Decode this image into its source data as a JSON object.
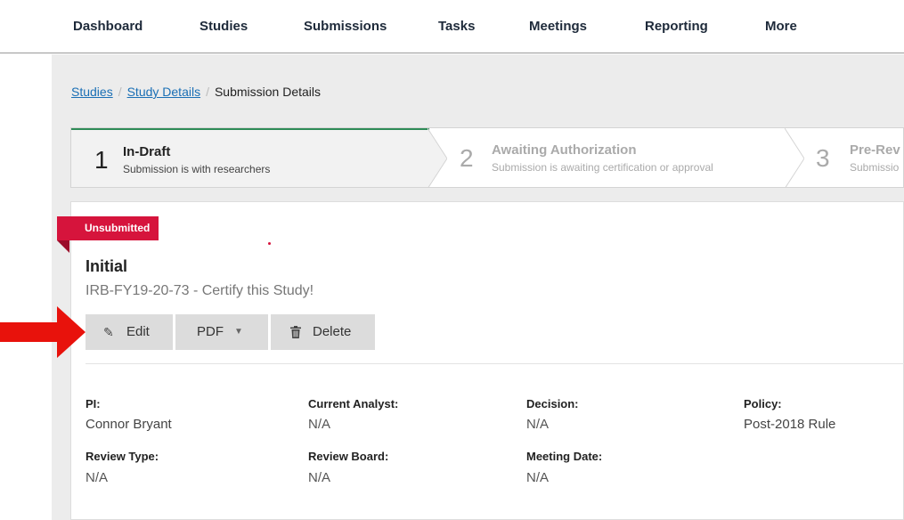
{
  "nav": {
    "items": [
      "Dashboard",
      "Studies",
      "Submissions",
      "Tasks",
      "Meetings",
      "Reporting",
      "More"
    ]
  },
  "breadcrumb": {
    "studies": "Studies",
    "study_details": "Study Details",
    "sep": "/",
    "current": "Submission Details"
  },
  "stepper": {
    "steps": [
      {
        "num": "1",
        "title": "In-Draft",
        "subtitle": "Submission is with researchers"
      },
      {
        "num": "2",
        "title": "Awaiting Authorization",
        "subtitle": "Submission is awaiting certification or approval"
      },
      {
        "num": "3",
        "title": "Pre-Rev",
        "subtitle": "Submissio"
      }
    ]
  },
  "submission": {
    "status_badge": "Unsubmitted",
    "type": "Initial",
    "description": "IRB-FY19-20-73 - Certify this Study!"
  },
  "actions": {
    "edit": "Edit",
    "pdf": "PDF",
    "delete": "Delete"
  },
  "fields": {
    "pi_label": "PI:",
    "pi_value": "Connor Bryant",
    "analyst_label": "Current Analyst:",
    "analyst_value": "N/A",
    "decision_label": "Decision:",
    "decision_value": "N/A",
    "policy_label": "Policy:",
    "policy_value": "Post-2018 Rule",
    "review_type_label": "Review Type:",
    "review_type_value": "N/A",
    "review_board_label": "Review Board:",
    "review_board_value": "N/A",
    "meeting_date_label": "Meeting Date:",
    "meeting_date_value": "N/A"
  },
  "colors": {
    "badge": "#d6143c",
    "link": "#1a6fb5",
    "step_active_border": "#2e8b57",
    "annotation_arrow": "#e8120c"
  },
  "icons": {
    "edit": "pencil-icon",
    "pdf": "caret-down-icon",
    "delete": "trash-icon"
  }
}
